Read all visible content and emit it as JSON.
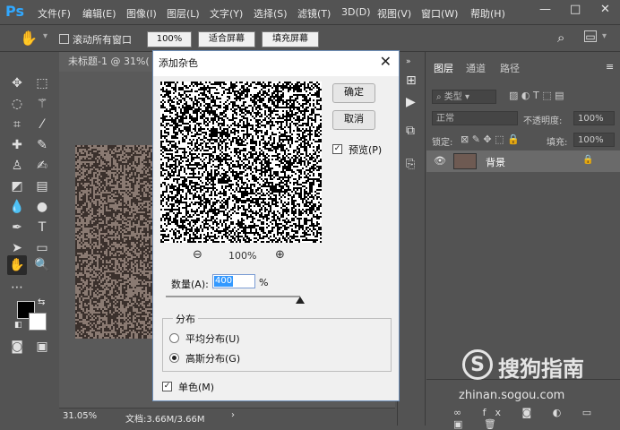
{
  "app": {
    "logo": "Ps"
  },
  "menubar": {
    "items": [
      "文件(F)",
      "编辑(E)",
      "图像(I)",
      "图层(L)",
      "文字(Y)",
      "选择(S)",
      "滤镜(T)",
      "3D(D)",
      "视图(V)",
      "窗口(W)",
      "帮助(H)"
    ],
    "window_buttons": [
      "—",
      "□",
      "✕"
    ]
  },
  "options_bar": {
    "scroll_all_label": "滚动所有窗口",
    "zoom_value": "100%",
    "fit_screen_label": "适合屏幕",
    "fill_screen_label": "填充屏幕"
  },
  "document": {
    "tab_title": "未标题-1 @ 31%(",
    "zoom_status": "31.05%",
    "doc_size": "文档:3.66M/3.66M"
  },
  "dialog": {
    "title": "添加杂色",
    "ok_label": "确定",
    "cancel_label": "取消",
    "preview_label": "预览(P)",
    "preview_zoom": "100%",
    "amount_label": "数量(A):",
    "amount_value": "400",
    "amount_unit": "%",
    "amount_slider": 1.0,
    "distribution_label": "分布",
    "uniform_label": "平均分布(U)",
    "gaussian_label": "高斯分布(G)",
    "mono_label": "单色(M)",
    "close_icon": "✕"
  },
  "layers_panel": {
    "tabs": [
      "图层",
      "通道",
      "路径"
    ],
    "filter_kind": "类型",
    "blend_mode": "正常",
    "opacity_label": "不透明度:",
    "opacity_value": "100%",
    "lock_label": "锁定:",
    "fill_label": "填充:",
    "fill_value": "100%",
    "layer_name": "背景"
  },
  "watermark": {
    "brand": "搜狗指南",
    "url": "zhinan.sogou.com"
  },
  "colors": {
    "accent": "#31a8ff",
    "dialog_bg": "#f0f0f0",
    "ui_bg": "#535353"
  }
}
